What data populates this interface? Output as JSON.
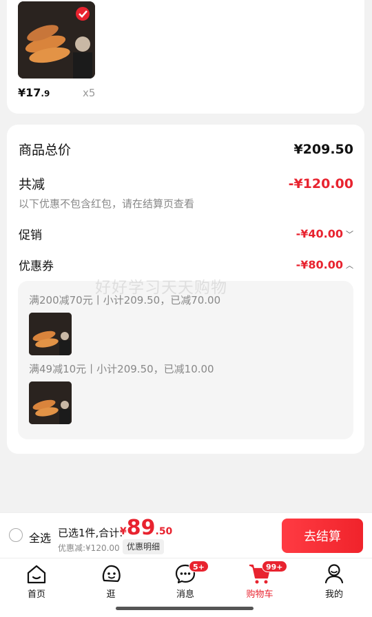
{
  "top_item": {
    "price_int": "¥17",
    "price_dec": ".9",
    "quantity": "x5"
  },
  "summary": {
    "total_label": "商品总价",
    "total_value": "¥209.50",
    "reduce_label": "共减",
    "reduce_value": "-¥120.00",
    "reduce_note": "以下优惠不包含红包，请在结算页查看",
    "promo_label": "促销",
    "promo_value": "-¥40.00",
    "coupon_label": "优惠券",
    "coupon_value": "-¥80.00",
    "coupons": [
      "满200减70元丨小计209.50，已减70.00",
      "满49减10元丨小计209.50，已减10.00"
    ],
    "watermark": "好好学习天天购物"
  },
  "checkout": {
    "select_all": "全选",
    "selected_text": "已选1件,合计:",
    "currency": "¥",
    "total_int": "89",
    "total_dec": ".50",
    "discount_note": "优惠减:¥120.00",
    "detail_label": "优惠明细",
    "button_label": "去结算"
  },
  "tabs": [
    {
      "label": "首页",
      "icon": "home-icon"
    },
    {
      "label": "逛",
      "icon": "browse-icon"
    },
    {
      "label": "消息",
      "icon": "message-icon",
      "badge": "5+"
    },
    {
      "label": "购物车",
      "icon": "cart-icon",
      "badge": "99+",
      "active": true
    },
    {
      "label": "我的",
      "icon": "profile-icon"
    }
  ],
  "colors": {
    "accent": "#e8232f",
    "background": "#f2f2f2"
  }
}
